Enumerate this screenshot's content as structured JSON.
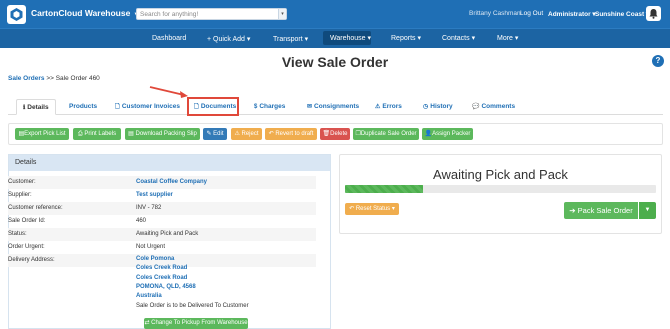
{
  "app": {
    "name": "CartonCloud Warehouse"
  },
  "search": {
    "placeholder": "Search for anything!"
  },
  "topbar": {
    "user": "Brittany Cashman",
    "logout": "Log Out",
    "role": "Administrator",
    "location": "Sunshine Coast"
  },
  "nav": {
    "items": [
      {
        "label": "Dashboard"
      },
      {
        "label": "+ Quick Add"
      },
      {
        "label": "Transport"
      },
      {
        "label": "Warehouse"
      },
      {
        "label": "Reports"
      },
      {
        "label": "Contacts"
      },
      {
        "label": "More"
      }
    ]
  },
  "page": {
    "title": "View Sale Order",
    "help": "?"
  },
  "breadcrumb": {
    "parent": "Sale Orders",
    "sep": ">>",
    "current": "Sale Order 460"
  },
  "tabs": [
    {
      "label": "Details",
      "icon": "info-icon"
    },
    {
      "label": "Products",
      "icon": ""
    },
    {
      "label": "Customer Invoices",
      "icon": "file-icon"
    },
    {
      "label": "Documents",
      "icon": "file-icon"
    },
    {
      "label": "Charges",
      "icon": "dollar-icon"
    },
    {
      "label": "Consignments",
      "icon": "envelope-icon"
    },
    {
      "label": "Errors",
      "icon": "warning-icon"
    },
    {
      "label": "History",
      "icon": "clock-icon"
    },
    {
      "label": "Comments",
      "icon": "comment-icon"
    }
  ],
  "actions": [
    {
      "label": "Export Pick List",
      "color": "#5cb85c"
    },
    {
      "label": "Print Labels",
      "color": "#5cb85c"
    },
    {
      "label": "Download Packing Slip",
      "color": "#5cb85c"
    },
    {
      "label": "Edit",
      "color": "#337ab7"
    },
    {
      "label": "Reject",
      "color": "#f0ad4e"
    },
    {
      "label": "Revert to draft",
      "color": "#f0ad4e"
    },
    {
      "label": "Delete",
      "color": "#d9534f"
    },
    {
      "label": "Duplicate Sale Order",
      "color": "#5cb85c"
    },
    {
      "label": "Assign Packer",
      "color": "#5cb85c"
    }
  ],
  "details": {
    "heading": "Details",
    "rows": [
      {
        "key": "Customer:",
        "value": "Coastal Coffee Company"
      },
      {
        "key": "Supplier:",
        "value": "Test supplier"
      },
      {
        "key": "Customer reference:",
        "value": "INV - 782"
      },
      {
        "key": "Sale Order Id:",
        "value": "460"
      },
      {
        "key": "Status:",
        "value": "Awaiting Pick and Pack"
      },
      {
        "key": "Order Urgent:",
        "value": "Not Urgent"
      },
      {
        "key": "Delivery Address:",
        "value": ""
      }
    ],
    "address": [
      "Cole Pomona",
      "Coles Creek Road",
      "Coles Creek Road",
      "POMONA, QLD, 4568",
      "Australia"
    ],
    "delivery_note": "Sale Order is to be Delivered To Customer",
    "change_button": "Change To Pickup From Warehouse"
  },
  "status": {
    "title": "Awaiting Pick and Pack",
    "progress": 0.25,
    "reset_label": "Reset Status",
    "pack_label": "Pack Sale Order"
  }
}
